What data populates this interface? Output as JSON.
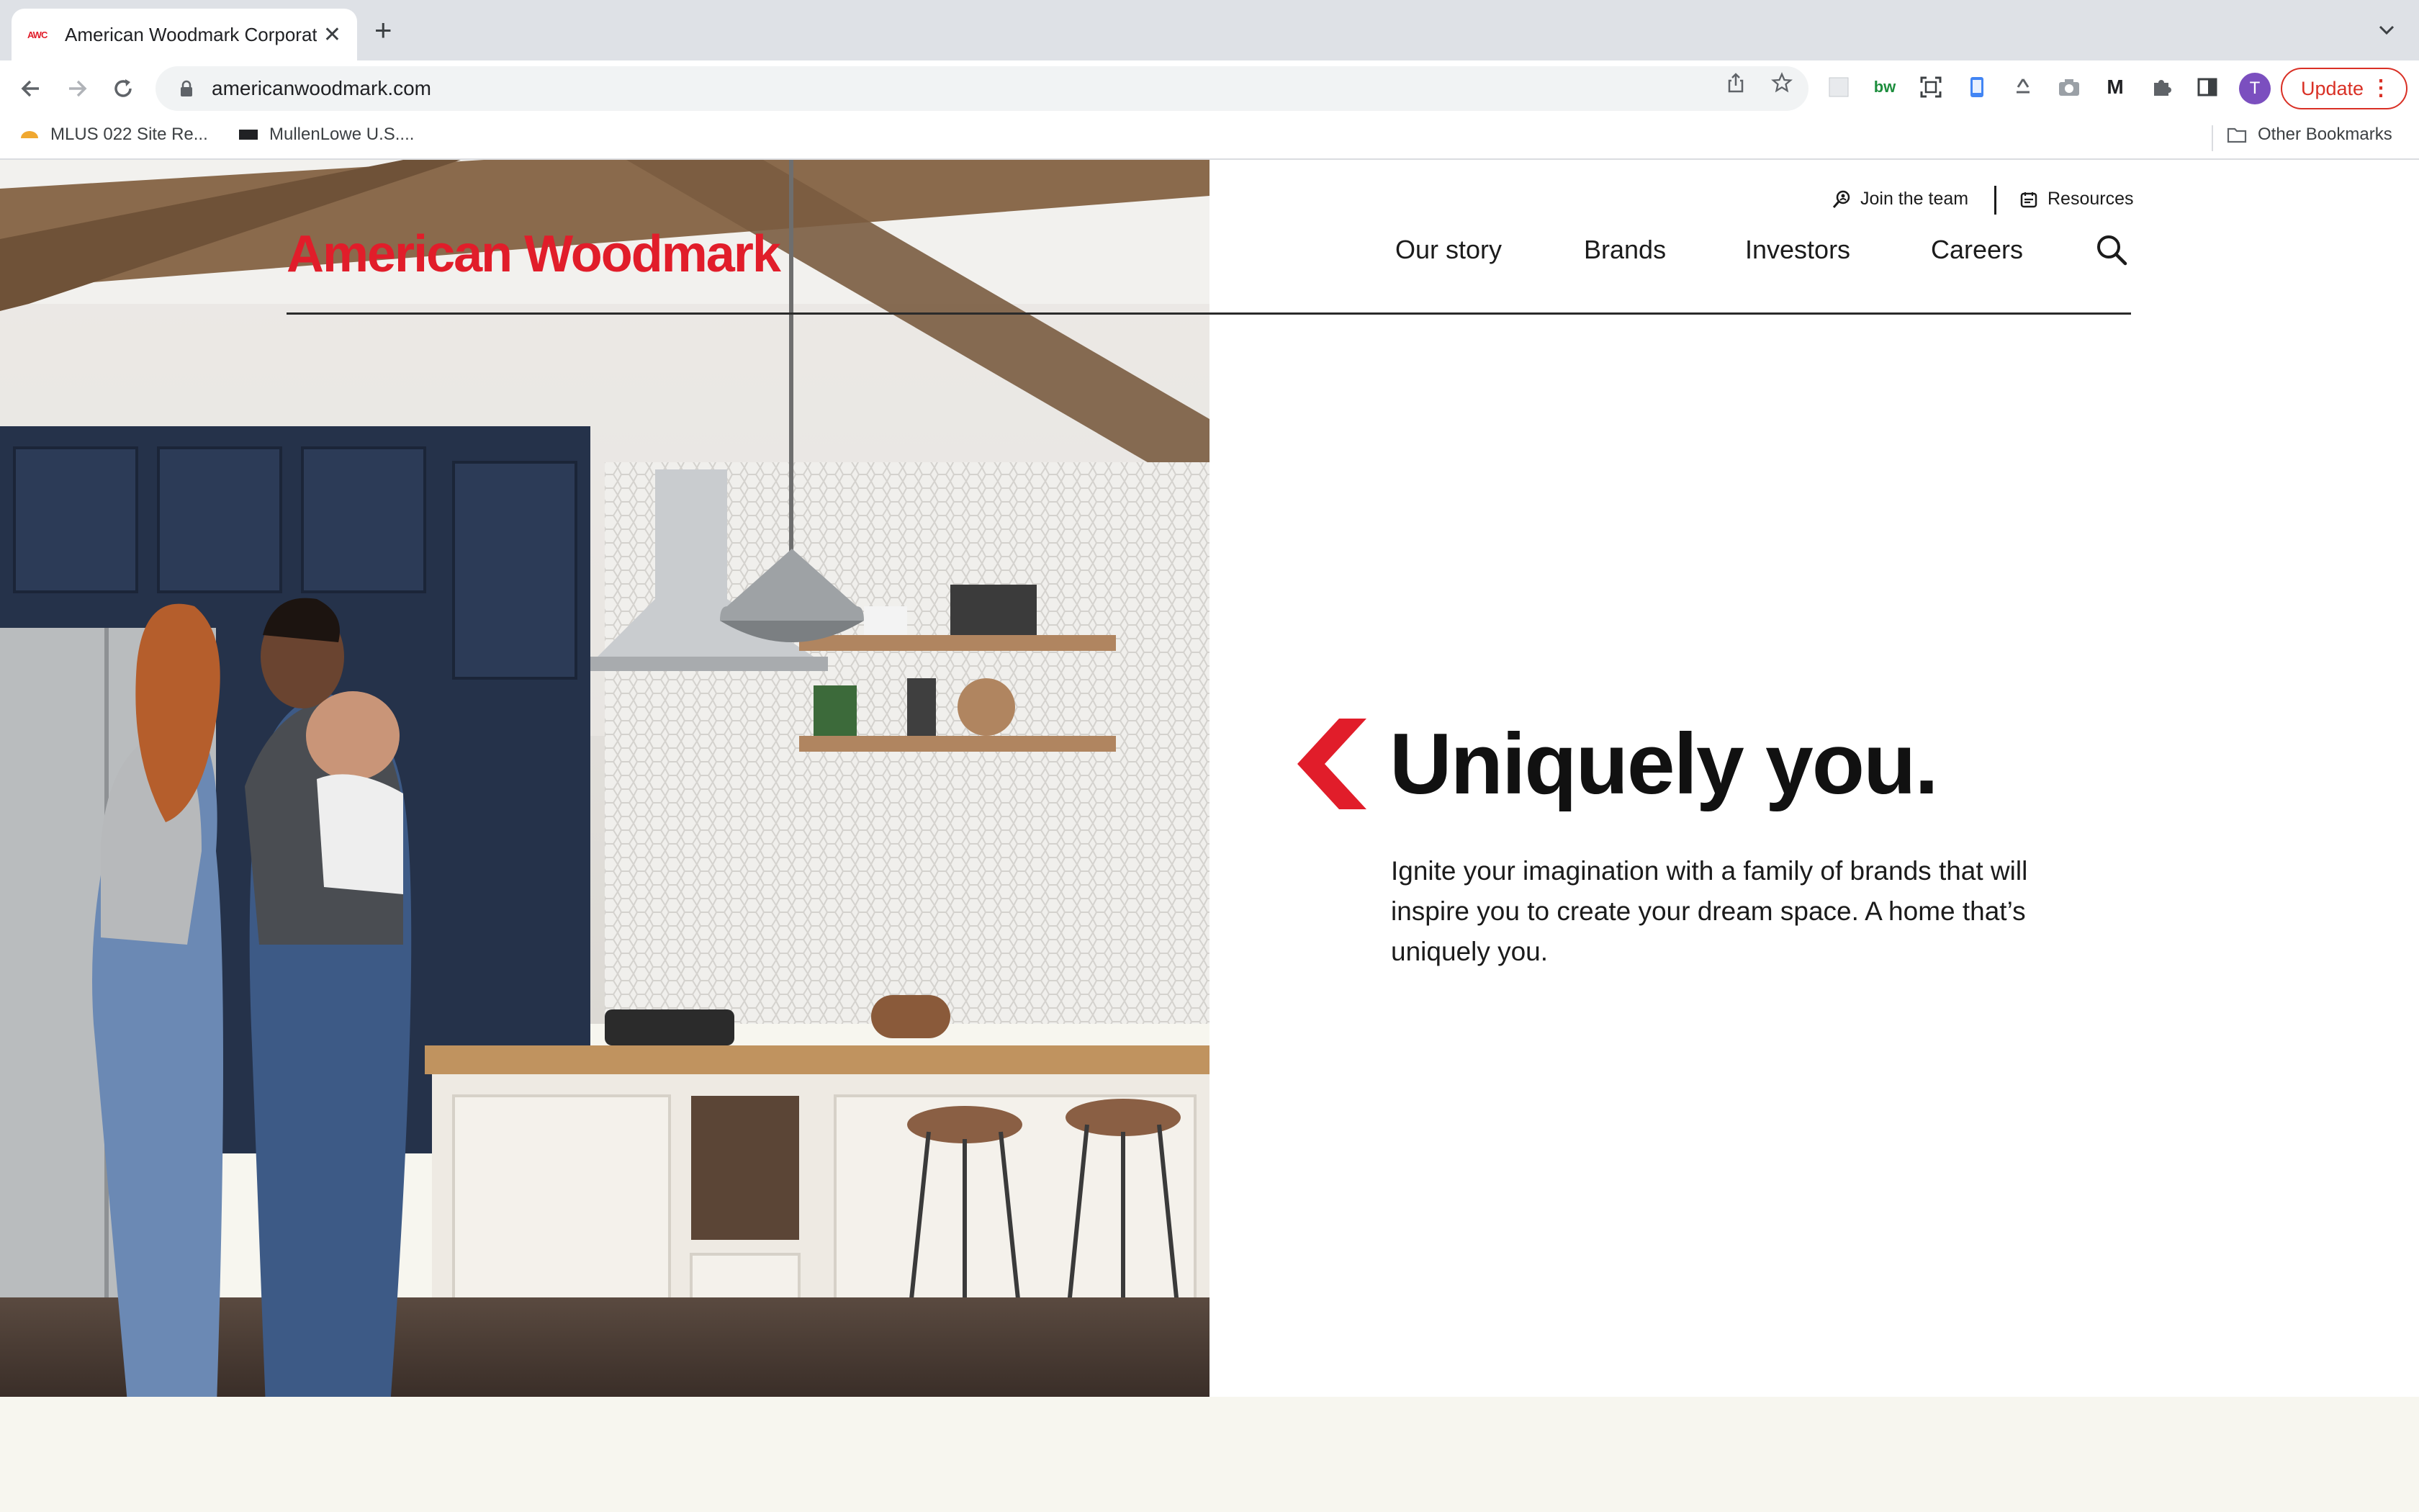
{
  "browser": {
    "tab_title": "American Woodmark Corporati",
    "tab_favicon_text": "AWC",
    "url": "americanwoodmark.com",
    "update_label": "Update",
    "profile_initial": "T",
    "bookmarks": [
      {
        "label": "MLUS 022 Site Re..."
      },
      {
        "label": "MullenLowe U.S...."
      }
    ],
    "other_bookmarks": "Other Bookmarks",
    "extensions": [
      "bw"
    ]
  },
  "site": {
    "logo": "American Woodmark",
    "utility": {
      "join_team": "Join the team",
      "resources": "Resources"
    },
    "nav": [
      "Our story",
      "Brands",
      "Investors",
      "Careers"
    ],
    "hero": {
      "headline": "Uniquely you.",
      "body": "Ignite your imagination with a family of brands that will inspire you to create your dream space. A home that’s uniquely you."
    },
    "colors": {
      "brand_red": "#e11d2a",
      "text_dark": "#111111",
      "footer_band": "#f7f6ef"
    }
  }
}
